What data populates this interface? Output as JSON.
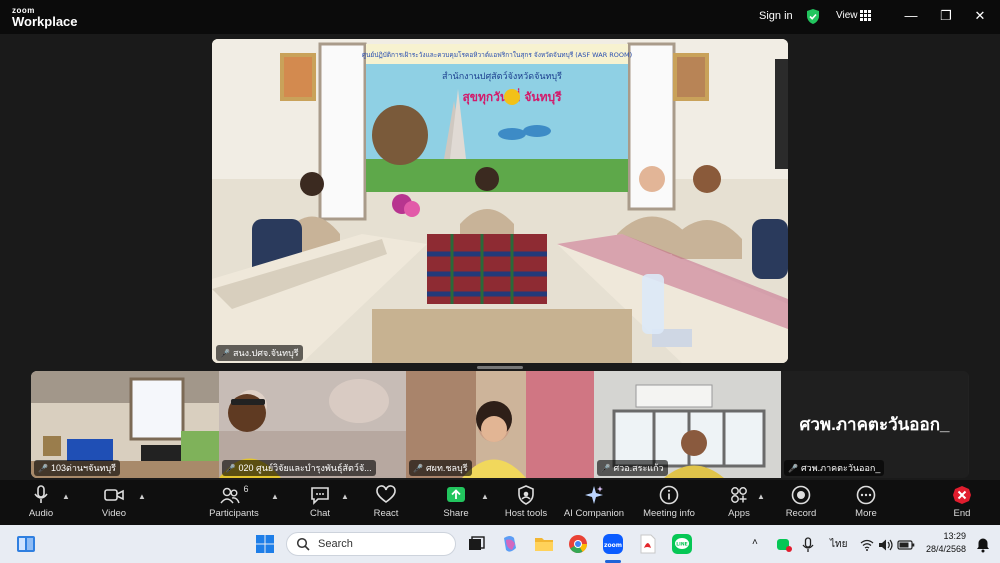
{
  "app": {
    "logo_line1": "zoom",
    "logo_line2": "Workplace",
    "sign_in": "Sign in",
    "view": "View"
  },
  "main_video": {
    "participant_name": "สนง.ปศจ.จันทบุรี",
    "banner_line": "ศูนย์ปฏิบัติการเฝ้าระวังและควบคุมโรคอหิวาต์แอฟริกาในสุกร จังหวัดจันทบุรี (ASF WAR ROOM)"
  },
  "participants": [
    {
      "name": "103ด่านฯจันทบุรี",
      "muted": true
    },
    {
      "name": "020 ศูนย์วิจัยและบำรุงพันธุ์สัตว์จั...",
      "muted": true
    },
    {
      "name": "ศผท.ชลบุรี",
      "muted": true
    },
    {
      "name": "ศวอ.สระแก้ว",
      "muted": true
    },
    {
      "name": "ศวพ.ภาคตะวันออก_",
      "muted": true,
      "display_name": "ศวพ.ภาคตะวันออก_"
    }
  ],
  "toolbar": {
    "audio": "Audio",
    "video": "Video",
    "participants": "Participants",
    "participants_count": "6",
    "chat": "Chat",
    "react": "React",
    "share": "Share",
    "host_tools": "Host tools",
    "ai_companion": "AI Companion",
    "meeting_info": "Meeting info",
    "apps": "Apps",
    "record": "Record",
    "more": "More",
    "end": "End"
  },
  "taskbar": {
    "search_placeholder": "Search",
    "language": "ไทย",
    "time": "13:29",
    "date": "28/4/2568"
  },
  "colors": {
    "accent_green": "#22c55e",
    "end_red": "#e11d2e",
    "titlebar": "#0b0b0b"
  }
}
